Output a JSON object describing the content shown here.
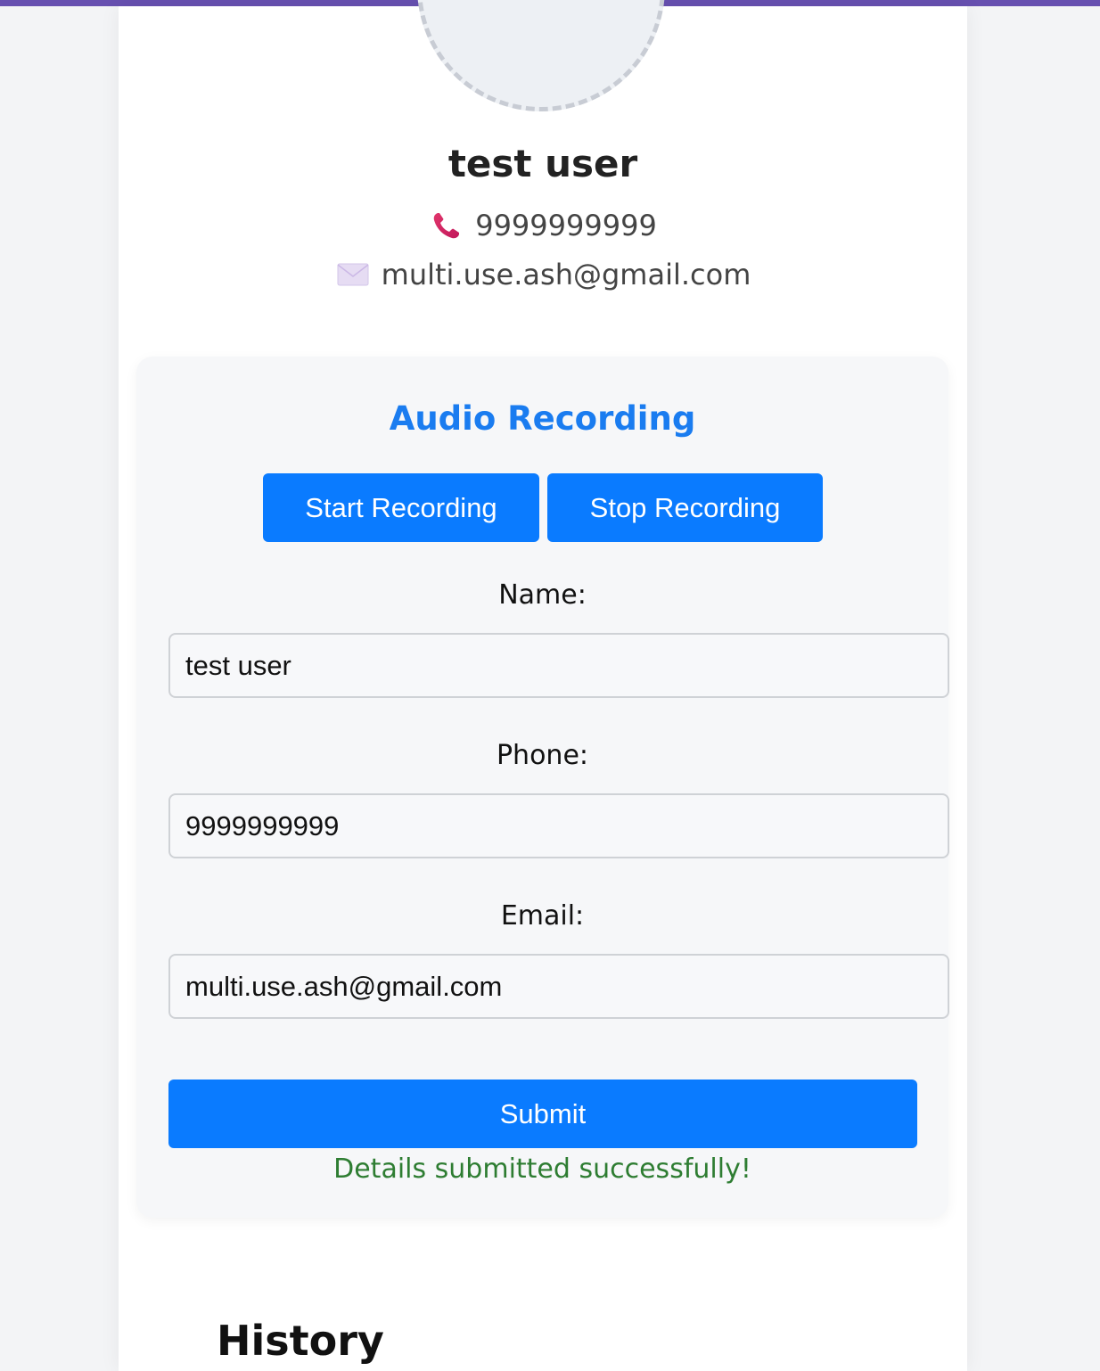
{
  "colors": {
    "top_bar": "#6750b0",
    "accent": "#0a7bff",
    "title_blue": "#1a7cf0",
    "success_green": "#2e7d32"
  },
  "profile": {
    "name": "test user",
    "phone": "9999999999",
    "email": "multi.use.ash@gmail.com",
    "phone_icon": "telephone-receiver-icon",
    "email_icon": "envelope-icon"
  },
  "panel": {
    "title": "Audio Recording",
    "start_label": "Start Recording",
    "stop_label": "Stop Recording",
    "name_label": "Name:",
    "name_value": "test user",
    "phone_label": "Phone:",
    "phone_value": "9999999999",
    "email_label": "Email:",
    "email_value": "multi.use.ash@gmail.com",
    "submit_label": "Submit",
    "success_message": "Details submitted successfully!"
  },
  "history": {
    "title": "History"
  }
}
